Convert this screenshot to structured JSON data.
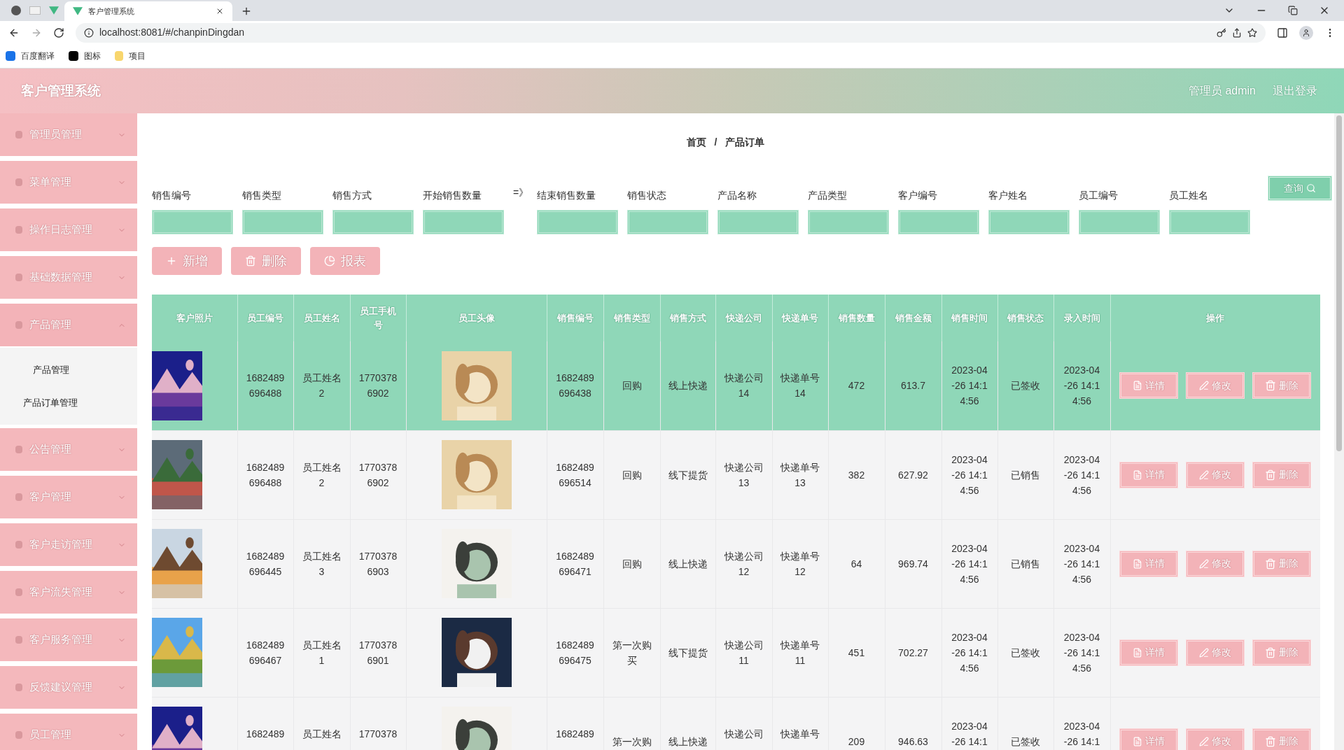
{
  "browser": {
    "tabs": [
      {
        "title": "客户管理系统",
        "selected": true
      }
    ],
    "url": "localhost:8081/#/chanpinDingdan",
    "bookmarks": [
      "百度翻译",
      "图标",
      "项目"
    ]
  },
  "header": {
    "title": "客户管理系统",
    "user": "管理员 admin",
    "logout": "退出登录"
  },
  "sidebar": {
    "items": [
      {
        "label": "管理员管理",
        "expanded": false
      },
      {
        "label": "菜单管理",
        "expanded": false
      },
      {
        "label": "操作日志管理",
        "expanded": false
      },
      {
        "label": "基础数据管理",
        "expanded": false
      },
      {
        "label": "产品管理",
        "expanded": true,
        "children": [
          {
            "label": "产品管理"
          },
          {
            "label": "产品订单管理"
          }
        ]
      },
      {
        "label": "公告管理",
        "expanded": false
      },
      {
        "label": "客户管理",
        "expanded": false
      },
      {
        "label": "客户走访管理",
        "expanded": false
      },
      {
        "label": "客户流失管理",
        "expanded": false
      },
      {
        "label": "客户服务管理",
        "expanded": false
      },
      {
        "label": "反馈建议管理",
        "expanded": false
      },
      {
        "label": "员工管理",
        "expanded": false
      }
    ]
  },
  "breadcrumb": [
    "首页",
    "/",
    "产品订单"
  ],
  "filters": [
    {
      "label": "销售编号"
    },
    {
      "label": "销售类型"
    },
    {
      "label": "销售方式"
    },
    {
      "label": "开始销售数量"
    },
    {
      "label": "=》",
      "kind": "separator"
    },
    {
      "label": "结束销售数量"
    },
    {
      "label": "销售状态"
    },
    {
      "label": "产品名称"
    },
    {
      "label": "产品类型"
    },
    {
      "label": "客户编号"
    },
    {
      "label": "客户姓名"
    },
    {
      "label": "员工编号"
    },
    {
      "label": "员工姓名"
    }
  ],
  "search_button": "查询",
  "actions": [
    {
      "label": "新增",
      "kind": "add"
    },
    {
      "label": "删除",
      "kind": "delete"
    },
    {
      "label": "报表",
      "kind": "report"
    }
  ],
  "table": {
    "columns": [
      "客户照片",
      "员工编号",
      "员工姓名",
      "员工手机号",
      "员工头像",
      "销售编号",
      "销售类型",
      "销售方式",
      "快递公司",
      "快递单号",
      "销售数量",
      "销售金额",
      "销售时间",
      "销售状态",
      "录入时间",
      "操作"
    ],
    "rows": [
      {
        "selected": true,
        "cells": [
          {
            "kind": "picture"
          },
          "1682489696488",
          "员工姓名2",
          "17703786902",
          {
            "kind": "picture"
          },
          "1682489696438",
          "回购",
          "线上快递",
          "快递公司14",
          "快递单号14",
          "472",
          "613.7",
          "2023-04-26 14:14:56",
          "已签收",
          "2023-04-26 14:14:56",
          {
            "kind": "actions",
            "buttons": [
              {
                "label": "详情",
                "kind": "detail"
              },
              {
                "label": "修改",
                "kind": "edit"
              },
              {
                "label": "删除",
                "kind": "delete"
              }
            ]
          }
        ]
      },
      {
        "selected": false,
        "cells": [
          {
            "kind": "picture"
          },
          "1682489696488",
          "员工姓名2",
          "17703786902",
          {
            "kind": "picture"
          },
          "1682489696514",
          "回购",
          "线下提货",
          "快递公司13",
          "快递单号13",
          "382",
          "627.92",
          "2023-04-26 14:14:56",
          "已销售",
          "2023-04-26 14:14:56",
          {
            "kind": "actions",
            "buttons": [
              {
                "label": "详情",
                "kind": "detail"
              },
              {
                "label": "修改",
                "kind": "edit"
              },
              {
                "label": "删除",
                "kind": "delete"
              }
            ]
          }
        ]
      },
      {
        "selected": false,
        "cells": [
          {
            "kind": "picture"
          },
          "1682489696445",
          "员工姓名3",
          "17703786903",
          {
            "kind": "picture"
          },
          "1682489696471",
          "回购",
          "线上快递",
          "快递公司12",
          "快递单号12",
          "64",
          "969.74",
          "2023-04-26 14:14:56",
          "已销售",
          "2023-04-26 14:14:56",
          {
            "kind": "actions",
            "buttons": [
              {
                "label": "详情",
                "kind": "detail"
              },
              {
                "label": "修改",
                "kind": "edit"
              },
              {
                "label": "删除",
                "kind": "delete"
              }
            ]
          }
        ]
      },
      {
        "selected": false,
        "cells": [
          {
            "kind": "picture"
          },
          "1682489696467",
          "员工姓名1",
          "17703786901",
          {
            "kind": "picture"
          },
          "1682489696475",
          "第一次购买",
          "线下提货",
          "快递公司11",
          "快递单号11",
          "451",
          "702.27",
          "2023-04-26 14:14:56",
          "已签收",
          "2023-04-26 14:14:56",
          {
            "kind": "actions",
            "buttons": [
              {
                "label": "详情",
                "kind": "detail"
              },
              {
                "label": "修改",
                "kind": "edit"
              },
              {
                "label": "删除",
                "kind": "delete"
              }
            ]
          }
        ]
      },
      {
        "selected": false,
        "cells": [
          {
            "kind": "picture"
          },
          "1682489",
          "员工姓名",
          "1770378",
          {
            "kind": "picture"
          },
          "1682489",
          "第一次购",
          "线上快递",
          "快递公司",
          "快递单号",
          "209",
          "946.63",
          "2023-04-26 14:1",
          "已签收",
          "2023-04-26 14:1",
          {
            "kind": "actions",
            "buttons": [
              {
                "label": "详情",
                "kind": "detail"
              },
              {
                "label": "修改",
                "kind": "edit"
              },
              {
                "label": "删除",
                "kind": "delete"
              }
            ]
          }
        ]
      }
    ]
  }
}
